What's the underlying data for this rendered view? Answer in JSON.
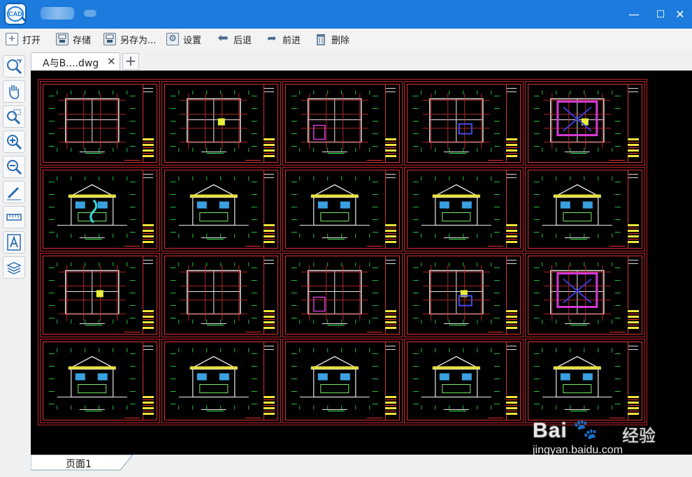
{
  "window": {
    "logo_text": "CAD",
    "minimize_glyph": "—",
    "maximize_glyph": "☐",
    "close_glyph": "✕"
  },
  "toolbar": {
    "items": [
      {
        "label": "打开",
        "icon": "plus-icon"
      },
      {
        "label": "存储",
        "icon": "save-icon"
      },
      {
        "label": "另存为...",
        "icon": "save-as-icon"
      },
      {
        "label": "设置",
        "icon": "gear-icon"
      },
      {
        "label": "后退",
        "icon": "back-arrow-icon"
      },
      {
        "label": "前进",
        "icon": "forward-arrow-icon"
      },
      {
        "label": "删除",
        "icon": "trash-icon"
      }
    ]
  },
  "left_tools": [
    "zoom-rotate-icon",
    "pan-hand-icon",
    "zoom-window-icon",
    "zoom-in-icon",
    "zoom-out-icon",
    "pencil-icon",
    "measure-ruler-icon",
    "text-icon",
    "layers-icon"
  ],
  "tabs": {
    "active_label": "A与B....dwg",
    "close_glyph": "✕",
    "add_glyph": "+"
  },
  "drawing": {
    "rows": 4,
    "columns": 5,
    "background": "#000000",
    "frame_color": "#c2262c"
  },
  "status": {
    "page_tab_label": "页面1"
  },
  "watermark": {
    "brand": "Bai",
    "brand2": "经验",
    "url": "jingyan.baidu.com"
  }
}
